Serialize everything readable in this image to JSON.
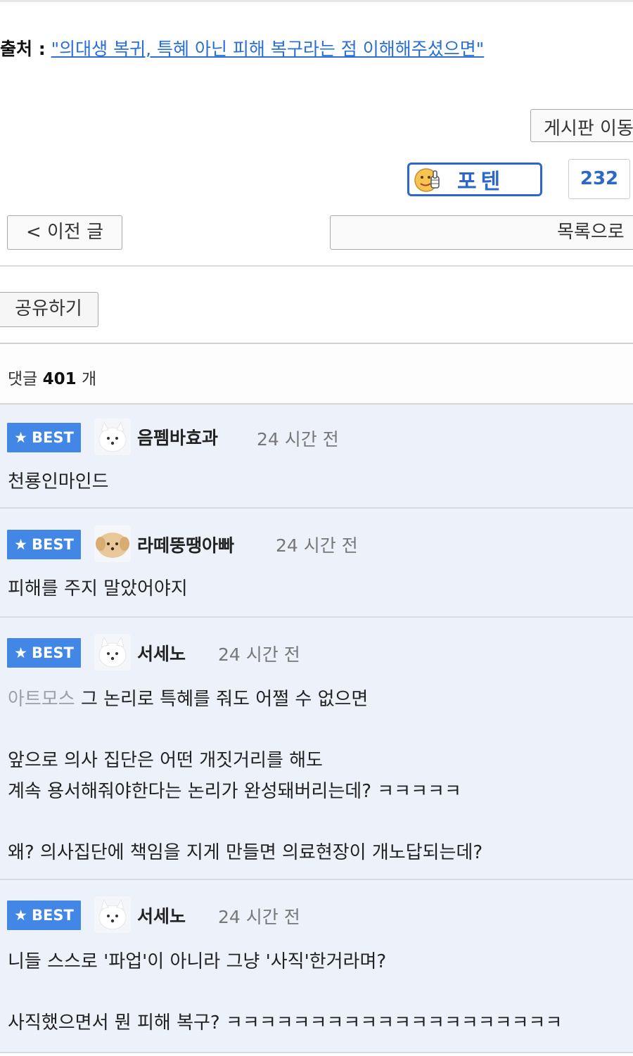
{
  "source": {
    "label": "출처 :",
    "link_text": "\"의대생 복귀, 특혜 아닌 피해 복구라는 점 이해해주셨으면\""
  },
  "buttons": {
    "board": "게시판 이동",
    "poten": "포텐",
    "poten_count": "232",
    "prev": "< 이전 글",
    "list": "목록으로",
    "share": "공유하기"
  },
  "comment_header": {
    "prefix": "댓글",
    "count": "401",
    "suffix": "개"
  },
  "comments": [
    {
      "badge": "BEST",
      "nick": "음펨바효과",
      "time": "24 시간 전",
      "avatar": "white-dog",
      "lines": [
        "천룡인마인드"
      ]
    },
    {
      "badge": "BEST",
      "nick": "라떼뚱땡아빠",
      "time": "24 시간 전",
      "avatar": "brown-dog",
      "lines": [
        "피해를 주지 말았어야지"
      ]
    },
    {
      "badge": "BEST",
      "nick": "서세노",
      "time": "24 시간 전",
      "avatar": "white-dog",
      "mention": "아트모스",
      "lines": [
        "그 논리로 특혜를 줘도 어쩔 수 없으면",
        "앞으로 의사 집단은 어떤 개짓거리를 해도",
        "계속 용서해줘야한다는 논리가 완성돼버리는데? ㅋㅋㅋㅋㅋ",
        "왜? 의사집단에 책임을 지게 만들면 의료현장이 개노답되는데?"
      ]
    },
    {
      "badge": "BEST",
      "nick": "서세노",
      "time": "24 시간 전",
      "avatar": "white-dog",
      "lines": [
        "니들 스스로 '파업'이 아니라 그냥 '사직'한거라며?",
        "사직했으면서 뭔 피해 복구? ㅋㅋㅋㅋㅋㅋㅋㅋㅋㅋㅋㅋㅋㅋㅋㅋㅋㅋㅋㅋ"
      ]
    }
  ],
  "colors": {
    "accent": "#2d68c8",
    "best_badge": "#4287e6",
    "comment_bg": "#edf2fa",
    "link": "#2a6fd6"
  }
}
